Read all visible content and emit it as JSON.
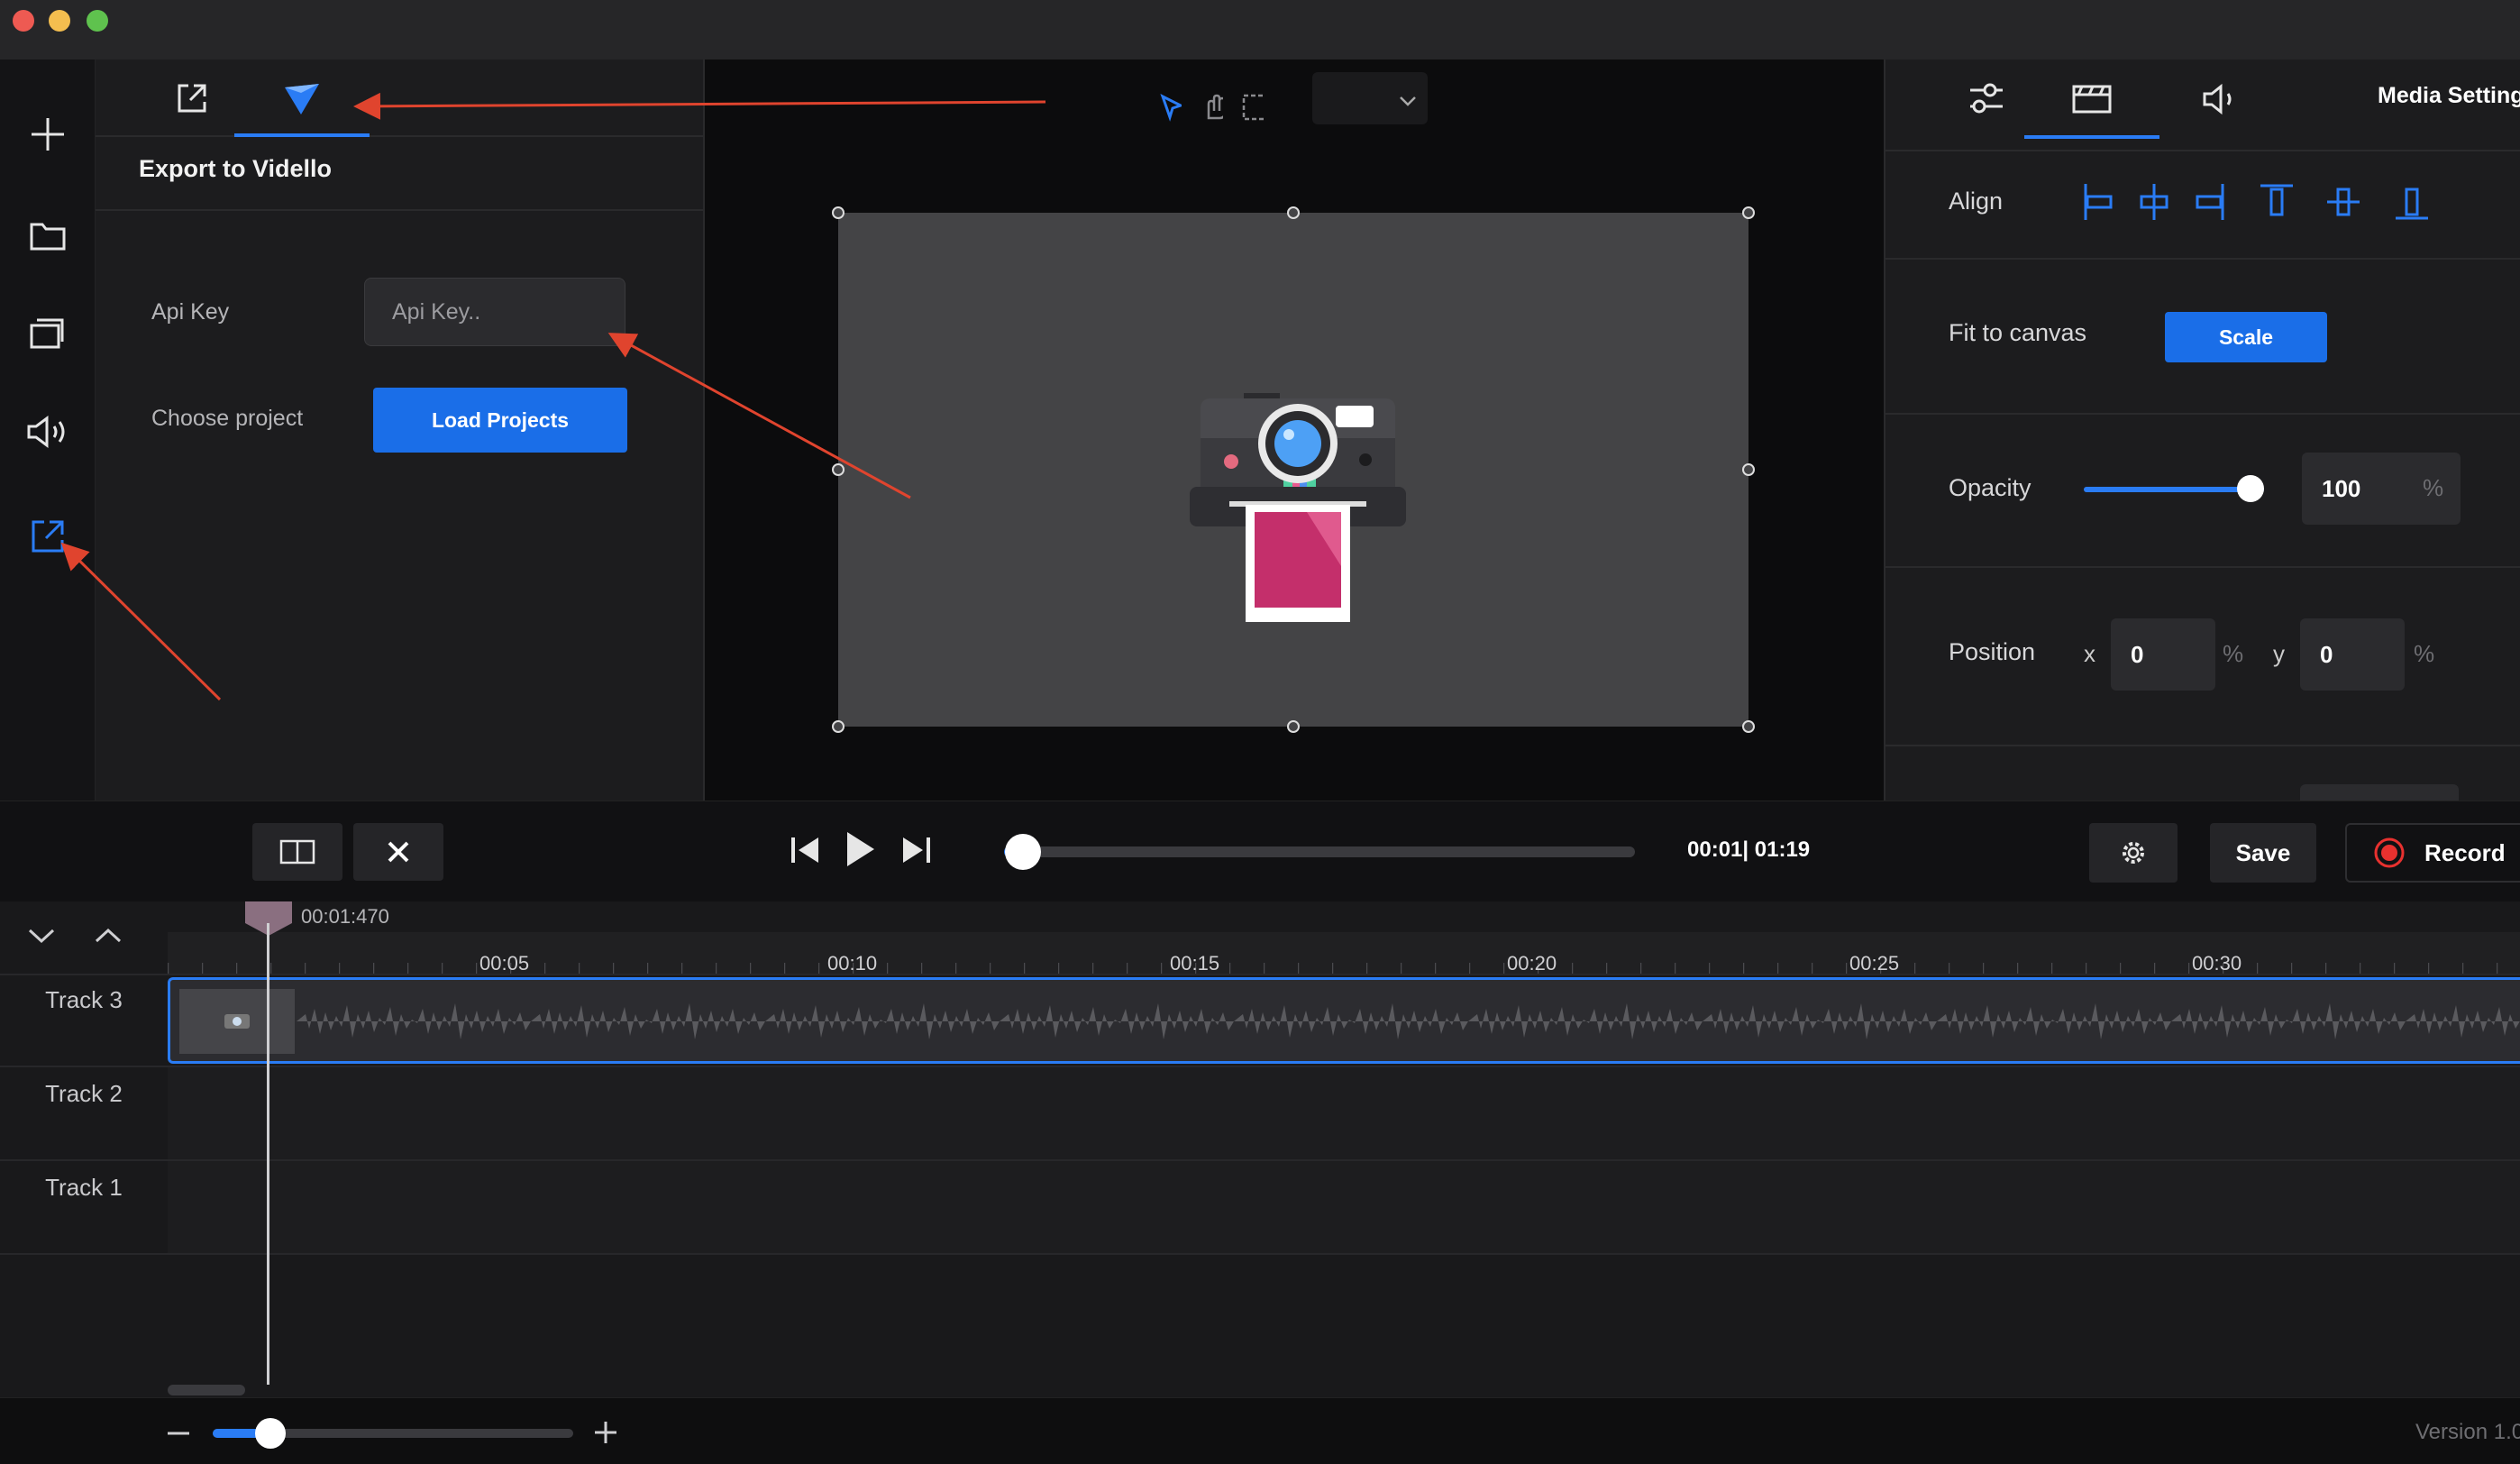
{
  "window": {
    "traffic_lights": {
      "close": "#ee5a52",
      "minimize": "#f4be4f",
      "zoom": "#5fc24e"
    }
  },
  "rail": {
    "items": [
      {
        "icon": "plus-icon"
      },
      {
        "icon": "folder-icon"
      },
      {
        "icon": "layers-icon"
      },
      {
        "icon": "speaker-icon"
      },
      {
        "icon": "export-icon",
        "active": true
      }
    ]
  },
  "export_panel": {
    "tabs": [
      {
        "icon": "external-link-icon"
      },
      {
        "icon": "vidello-logo-icon",
        "active": true
      }
    ],
    "heading": "Export to Vidello",
    "api_key_label": "Api Key",
    "api_key_placeholder": "Api Key..",
    "choose_project_label": "Choose project",
    "load_button": "Load Projects"
  },
  "preview": {
    "tools": [
      "pointer-icon",
      "hand-icon",
      "marquee-icon"
    ],
    "zoom_select_value": ""
  },
  "right_panel": {
    "tabs": [
      {
        "icon": "sliders-icon"
      },
      {
        "icon": "video-clip-icon",
        "active": true
      },
      {
        "icon": "speaker-icon"
      }
    ],
    "title": "Media Settings",
    "align_label": "Align",
    "fit_label": "Fit to canvas",
    "scale_button": "Scale",
    "opacity_label": "Opacity",
    "opacity_value": "100",
    "opacity_fraction": 1.0,
    "percent": "%",
    "position_label": "Position",
    "x_label": "x",
    "x_value": "0",
    "y_label": "y",
    "y_value": "0"
  },
  "controls": {
    "time": "00:01| 01:19",
    "progress_fraction": 0.01,
    "save": "Save",
    "record": "Record"
  },
  "timeline": {
    "playhead_time": "00:01:470",
    "ticks": [
      "00:05",
      "00:10",
      "00:15",
      "00:20",
      "00:25",
      "00:30"
    ],
    "tracks": [
      "Track 3",
      "Track 2",
      "Track 1"
    ]
  },
  "footer": {
    "version": "Version 1.0",
    "zoom_fraction": 0.16
  },
  "colors": {
    "accent": "#1a6ee8",
    "record": "#e8312f",
    "annotation_arrow": "#e0442e"
  }
}
